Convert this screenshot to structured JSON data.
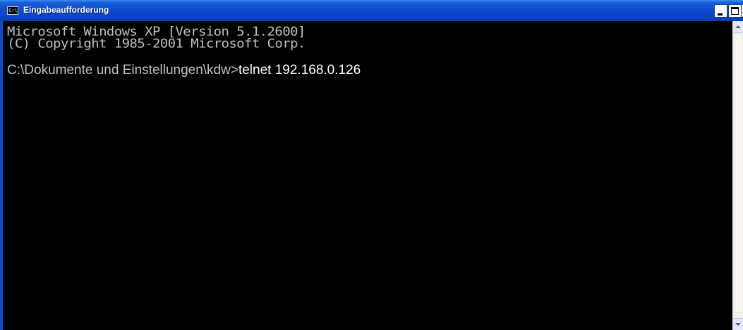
{
  "window": {
    "title": "Eingabeaufforderung",
    "icon": "command-prompt-icon",
    "icon_text": "C:\\",
    "controls": {
      "minimize_icon": "minimize-icon",
      "maximize_icon": "maximize-icon",
      "close_icon": "close-icon",
      "close_glyph": "×"
    }
  },
  "console": {
    "lines": [
      "Microsoft Windows XP [Version 5.1.2600]",
      "(C) Copyright 1985-2001 Microsoft Corp."
    ],
    "prompt": "C:\\Dokumente und Einstellungen\\kdw>",
    "command": "telnet 192.168.0.126"
  },
  "colors": {
    "titlebar": "#0a4ed0",
    "console_background": "#000000",
    "console_text": "#c0c0c0",
    "command_text": "#ffffff"
  }
}
